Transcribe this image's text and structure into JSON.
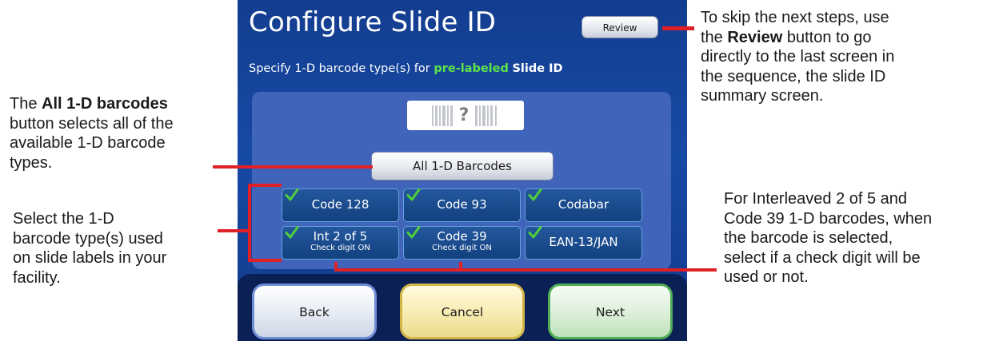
{
  "screen": {
    "title": "Configure Slide ID",
    "review_label": "Review",
    "subtitle": {
      "prefix": "Specify 1-D barcode type(s) for ",
      "highlight": "pre-labeled",
      "suffix": "Slide ID"
    },
    "barcode_symbol": "?",
    "all_barcodes_label": "All 1-D Barcodes",
    "barcode_types": [
      {
        "name": "Code 128",
        "sub": "",
        "checked": true
      },
      {
        "name": "Code 93",
        "sub": "",
        "checked": true
      },
      {
        "name": "Codabar",
        "sub": "",
        "checked": true
      },
      {
        "name": "Int 2 of 5",
        "sub": "Check digit ON",
        "checked": true
      },
      {
        "name": "Code 39",
        "sub": "Check digit ON",
        "checked": true
      },
      {
        "name": "EAN-13/JAN",
        "sub": "",
        "checked": true
      }
    ],
    "nav": {
      "back": "Back",
      "cancel": "Cancel",
      "next": "Next"
    }
  },
  "annotations": {
    "review": {
      "l1": "To skip the next steps, use",
      "l2_pre": "the ",
      "l2_bold": "Review",
      "l2_post": " button to go",
      "l3": "directly to the last screen in",
      "l4": "the sequence, the slide ID",
      "l5": "summary screen."
    },
    "all": {
      "l1_pre": "The ",
      "l1_bold": "All 1-D barcodes",
      "l2": "button selects all of the",
      "l3": "available 1-D barcode",
      "l4": "types."
    },
    "select": {
      "l1": "Select the 1-D",
      "l2": "barcode type(s) used",
      "l3": "on slide labels in your",
      "l4": "facility."
    },
    "check_digit": {
      "l1": "For Interleaved 2 of 5 and",
      "l2": "Code 39 1-D barcodes, when",
      "l3": "the barcode is selected,",
      "l4": "select if a check digit will be",
      "l5": "used or not."
    }
  },
  "colors": {
    "screen_bg": "#174aa5",
    "panel_bg": "#3f64b9",
    "tile_bg": "#12417f",
    "highlight_green": "#5de44a",
    "callout_red": "#e01f26",
    "check_green": "#4fcf3a"
  },
  "icons": [
    "check-icon",
    "barcode-icon"
  ]
}
